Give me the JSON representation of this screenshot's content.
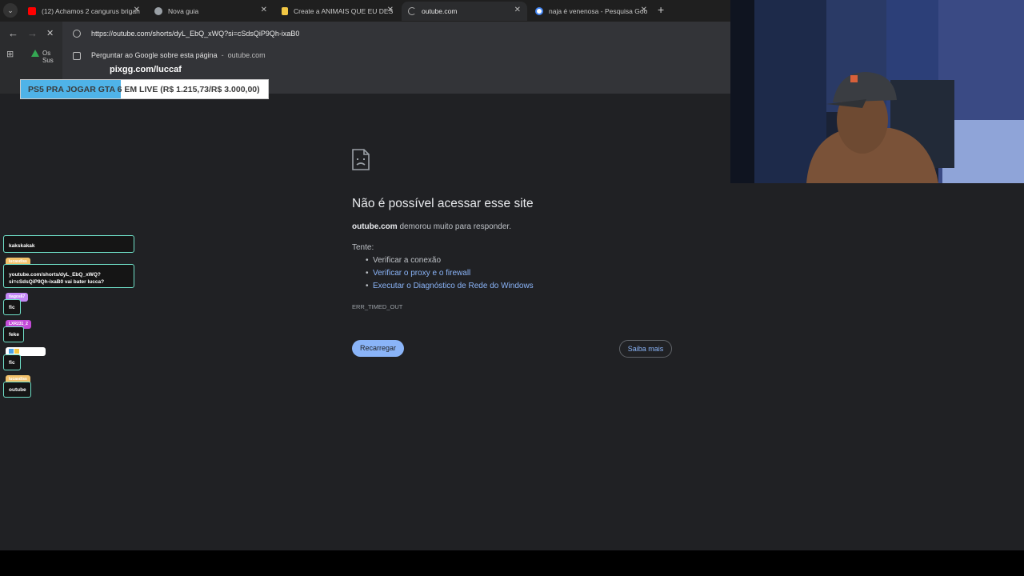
{
  "tabs": [
    {
      "label": "(12) Achamos 2 cangurus brigan",
      "favicon_color": "#ff0000",
      "active": false
    },
    {
      "label": "Nova guia",
      "favicon_color": "#aaaaaa",
      "active": false
    },
    {
      "label": "Create a ANIMAIS QUE EU DES",
      "favicon_color": "#f2c744",
      "active": false
    },
    {
      "label": "outube.com",
      "favicon_color": "#aaaaaa",
      "active": true
    },
    {
      "label": "naja é venenosa - Pesquisa Goo",
      "favicon_color": "#4285f4",
      "active": false
    }
  ],
  "tab_close": "✕",
  "new_tab": "+",
  "nav": {
    "back": "←",
    "forward": "→",
    "stop": "✕"
  },
  "omnibox": {
    "url": "https://outube.com/shorts/dyL_EbQ_xWQ?si=cSdsQiP9Qh-ixaB0",
    "ask_google": "Perguntar ao Google sobre esta página",
    "ask_sep": "-",
    "ask_domain": "outube.com"
  },
  "bookmarks": {
    "apps": "⊞",
    "label": "Os Sus"
  },
  "small_plus": "+",
  "error_page": {
    "title": "Não é possível acessar esse site",
    "domain": "outube.com",
    "desc": " demorou muito para responder.",
    "try_label": "Tente:",
    "suggestions": [
      {
        "text": "Verificar a conexão",
        "link": false
      },
      {
        "text": "Verificar o proxy e o firewall",
        "link": true
      },
      {
        "text": "Executar o Diagnóstico de Rede do Windows",
        "link": true
      }
    ],
    "error_code": "ERR_TIMED_OUT",
    "reload": "Recarregar",
    "more": "Saiba mais"
  },
  "overlay": {
    "pix": "pixgg.com/luccaf",
    "goal_text": "PS5 PRA JOGAR GTA 6 EM LIVE (R$ 1.215,73/R$ 3.000,00)",
    "goal_progress": 0.405
  },
  "chat": [
    {
      "name": "",
      "name_color": "",
      "text": "kakskakak"
    },
    {
      "name": "lucasdiss",
      "name_color": "#f2c16b",
      "text": "youtube.com/shorts/dyL_EbQ_xWQ? si=cSdsQiP9Qh-ixaB0 vai bater lucca?"
    },
    {
      "name": "tiagos67",
      "name_color": "#c387f5",
      "text": "fic"
    },
    {
      "name": "LXR231_2",
      "name_color": "#c34ad8",
      "text": "feke"
    },
    {
      "name": "",
      "name_color": "#ffffff",
      "text": "fic"
    },
    {
      "name": "lucasdiss",
      "name_color": "#f2c16b",
      "text": "outube"
    }
  ]
}
